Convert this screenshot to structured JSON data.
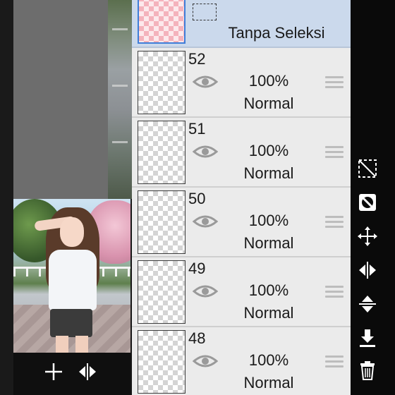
{
  "selection_row": {
    "label": "Tanpa Seleksi"
  },
  "layers": [
    {
      "number": "52",
      "opacity": "100%",
      "blend_mode": "Normal"
    },
    {
      "number": "51",
      "opacity": "100%",
      "blend_mode": "Normal"
    },
    {
      "number": "50",
      "opacity": "100%",
      "blend_mode": "Normal"
    },
    {
      "number": "49",
      "opacity": "100%",
      "blend_mode": "Normal"
    },
    {
      "number": "48",
      "opacity": "100%",
      "blend_mode": "Normal"
    }
  ],
  "photo_toolbar": {
    "icons": [
      "add-icon",
      "flip-horizontal-icon"
    ]
  },
  "tools": {
    "icons": [
      "clear-selection-icon",
      "invert-selection-icon",
      "move-icon",
      "flip-horizontal-icon",
      "flip-vertical-icon",
      "merge-down-icon",
      "delete-icon"
    ]
  },
  "colors": {
    "selection_row_bg": "#cbd9ec",
    "layer_row_bg": "#ebebeb",
    "selected_thumb_border": "#3f7ed9",
    "tool_strip_bg": "#0a0a0a"
  }
}
